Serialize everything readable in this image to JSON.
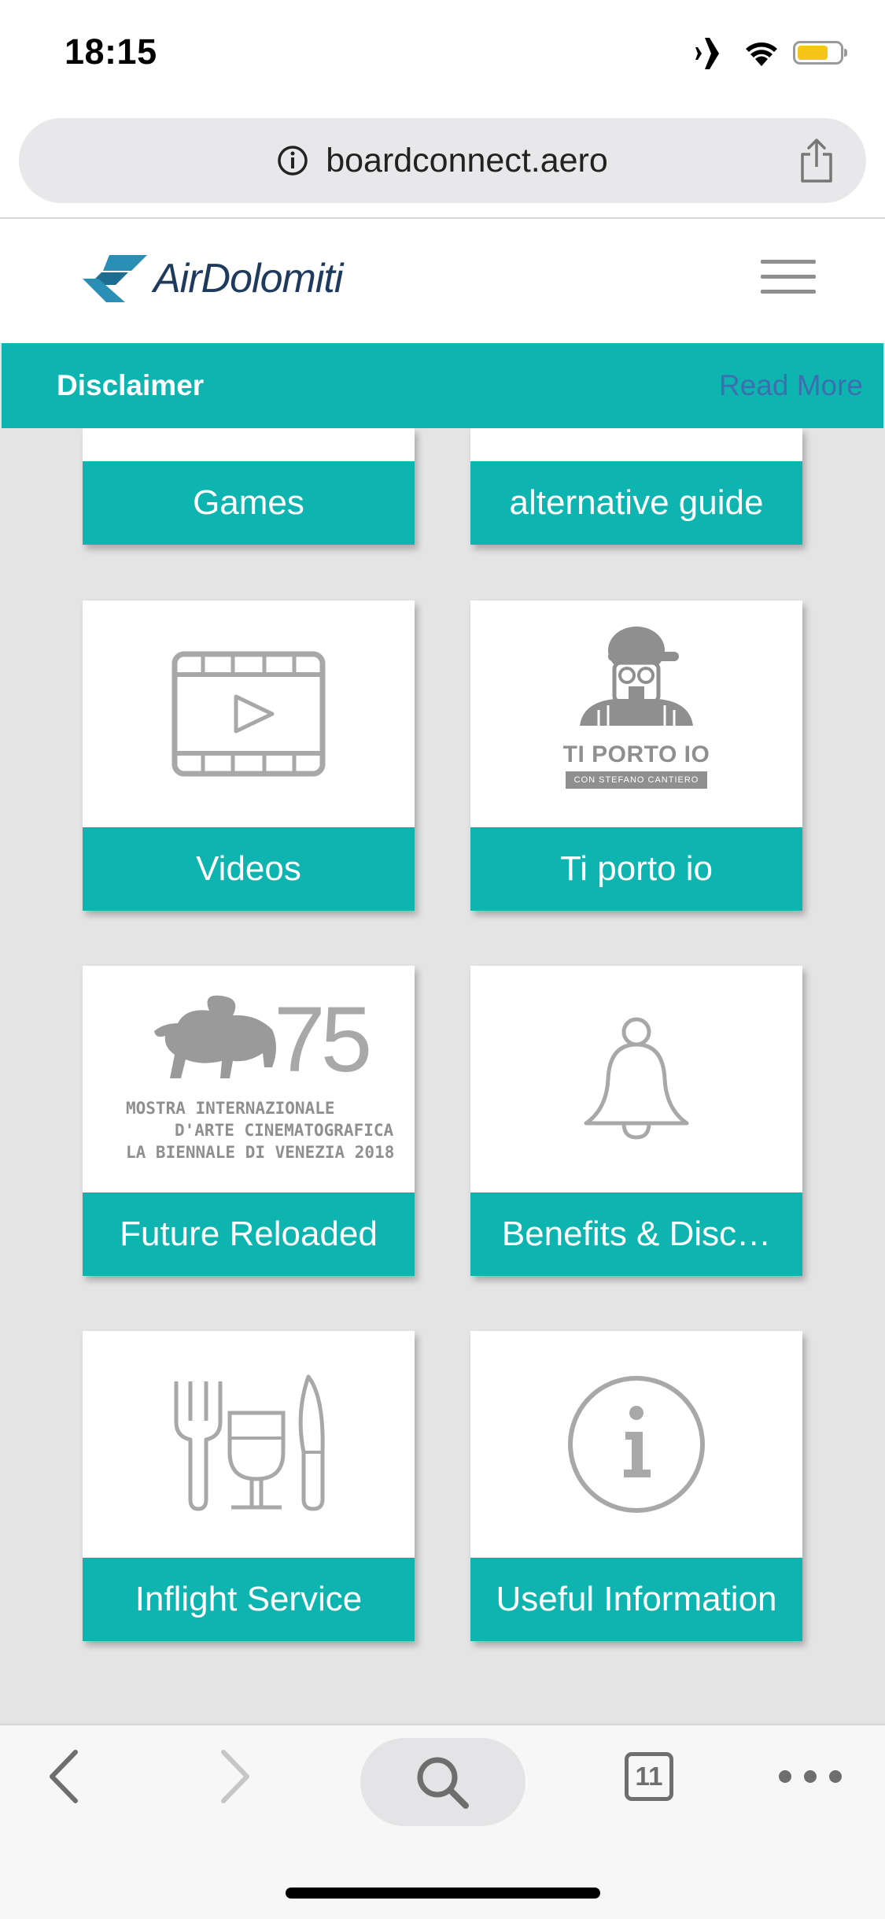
{
  "status_bar": {
    "time": "18:15",
    "icons": [
      "airplane-icon",
      "wifi-icon",
      "battery-icon"
    ],
    "battery_color": "#f5c518"
  },
  "url_bar": {
    "domain": "boardconnect.aero",
    "icons": [
      "info-icon",
      "share-icon"
    ]
  },
  "site_header": {
    "logo_text": "AirDolomiti",
    "menu_icon": "hamburger-icon",
    "logo_color": "#2a8fb5"
  },
  "disclaimer": {
    "title": "Disclaimer",
    "link": "Read More"
  },
  "tiles": [
    {
      "label": "Games",
      "icon": "none"
    },
    {
      "label": "alternative guide",
      "icon": "none"
    },
    {
      "label": "Videos",
      "icon": "video-frame-icon"
    },
    {
      "label": "Ti porto io",
      "icon": "ti-porto-io-logo",
      "logo_title": "TI PORTO IO",
      "logo_sub": "CON STEFANO CANTIERO"
    },
    {
      "label": "Future Reloaded",
      "icon": "biennale-logo",
      "logo_number": "75",
      "logo_lines": [
        "MOSTRA INTERNAZIONALE",
        "D'ARTE CINEMATOGRAFICA",
        "LA BIENNALE DI VENEZIA 2018"
      ]
    },
    {
      "label": "Benefits & Disc…",
      "icon": "bell-icon"
    },
    {
      "label": "Inflight Service",
      "icon": "cutlery-icon"
    },
    {
      "label": "Useful Information",
      "icon": "info-circle-icon"
    }
  ],
  "toolbar": {
    "tabs_count": "11",
    "icons": [
      "back-icon",
      "forward-icon",
      "search-icon",
      "tabs-icon",
      "more-icon"
    ]
  },
  "colors": {
    "accent": "#0eb5b0",
    "link": "#3d6fb0",
    "background": "#e4e4e5"
  }
}
